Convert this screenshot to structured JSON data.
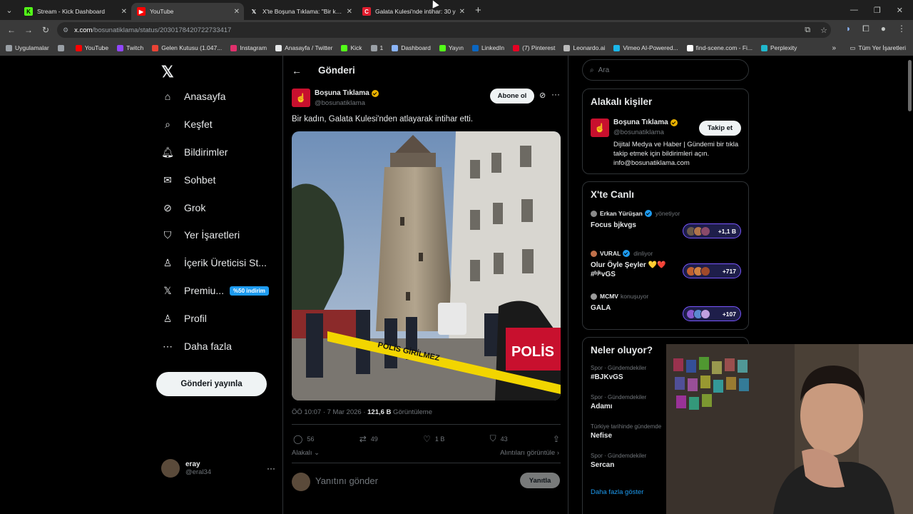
{
  "browser": {
    "tabs": [
      {
        "title": "Stream - Kick Dashboard",
        "icon": "kick-icon",
        "color": "#53fc18",
        "glyph": "K",
        "active": false
      },
      {
        "title": "YouTube",
        "icon": "youtube-icon",
        "color": "#ff0000",
        "glyph": "▶",
        "active": true
      },
      {
        "title": "X'te Boşuna Tıklama: \"Bir kadın",
        "icon": "x-icon",
        "color": "#1f1f1f",
        "glyph": "𝕏",
        "active": false
      },
      {
        "title": "Galata Kulesi'nde intihar: 30 y",
        "icon": "c-icon",
        "color": "#e11d2e",
        "glyph": "C",
        "active": false
      }
    ],
    "url_host": "x.com",
    "url_path": "/bosunatiklama/status/2030178420722733417",
    "bookmarks": [
      {
        "label": "Uygulamalar",
        "icon": "apps-icon",
        "color": "#9aa0a6"
      },
      {
        "label": "",
        "icon": "grid-icon",
        "color": "#9aa0a6"
      },
      {
        "label": "YouTube",
        "icon": "youtube-icon",
        "color": "#ff0000"
      },
      {
        "label": "Twitch",
        "icon": "twitch-icon",
        "color": "#9146ff"
      },
      {
        "label": "Gelen Kutusu (1.047...",
        "icon": "gmail-icon",
        "color": "#ea4335"
      },
      {
        "label": "Instagram",
        "icon": "instagram-icon",
        "color": "#e1306c"
      },
      {
        "label": "Anasayfa / Twitter",
        "icon": "x-icon",
        "color": "#e7e9ea"
      },
      {
        "label": "Kick",
        "icon": "kick-icon",
        "color": "#53fc18"
      },
      {
        "label": "1",
        "icon": "folder-icon",
        "color": "#9aa0a6"
      },
      {
        "label": "Dashboard",
        "icon": "dashboard-icon",
        "color": "#8ab4f8"
      },
      {
        "label": "Yayın",
        "icon": "kick-icon",
        "color": "#53fc18"
      },
      {
        "label": "LinkedIn",
        "icon": "linkedin-icon",
        "color": "#0a66c2"
      },
      {
        "label": "(7) Pinterest",
        "icon": "pinterest-icon",
        "color": "#e60023"
      },
      {
        "label": "Leonardo.ai",
        "icon": "leonardo-icon",
        "color": "#bbbbbb"
      },
      {
        "label": "Vimeo AI-Powered...",
        "icon": "vimeo-icon",
        "color": "#1ab7ea"
      },
      {
        "label": "find-scene.com - Fi...",
        "icon": "findscene-icon",
        "color": "#ffffff"
      },
      {
        "label": "Perplexity",
        "icon": "perplexity-icon",
        "color": "#20b8cd"
      }
    ],
    "all_bookmarks": "Tüm Yer İşaretleri"
  },
  "nav": {
    "items": [
      {
        "label": "Anasayfa",
        "icon": "home-icon",
        "glyph": "⌂"
      },
      {
        "label": "Keşfet",
        "icon": "search-icon",
        "glyph": "⌕"
      },
      {
        "label": "Bildirimler",
        "icon": "bell-icon",
        "glyph": "🔔︎"
      },
      {
        "label": "Sohbet",
        "icon": "mail-icon",
        "glyph": "✉"
      },
      {
        "label": "Grok",
        "icon": "grok-icon",
        "glyph": "⊘"
      },
      {
        "label": "Yer İşaretleri",
        "icon": "bookmark-icon",
        "glyph": "⛉"
      },
      {
        "label": "İçerik Üreticisi St...",
        "icon": "creator-icon",
        "glyph": "♙"
      },
      {
        "label": "Premiu...",
        "icon": "x-premium-icon",
        "glyph": "𝕏"
      },
      {
        "label": "Profil",
        "icon": "person-icon",
        "glyph": "♙"
      },
      {
        "label": "Daha fazla",
        "icon": "more-circle-icon",
        "glyph": "⋯"
      }
    ],
    "premium_badge": "%50 indirim",
    "post_button": "Gönderi yayınla",
    "user_name": "eray",
    "user_handle": "@eral34"
  },
  "post": {
    "header": "Gönderi",
    "author_name": "Boşuna Tıklama",
    "author_handle": "@bosunatiklama",
    "subscribe": "Abone ol",
    "text": "Bir kadın, Galata Kulesi'nden atlayarak intihar etti.",
    "time": "ÖÖ 10:07 · 7 Mar 2026 · ",
    "views": "121,6 B",
    "views_label": " Görüntüleme",
    "tape_text": "POLİS GİRİLMEZ",
    "police_text": "POLİS",
    "stats": {
      "replies": "56",
      "reposts": "49",
      "likes": "1 B",
      "bookmarks": "43"
    },
    "relevant": "Alakalı",
    "quotes": "Alıntıları görüntüle",
    "reply_placeholder": "Yanıtını gönder",
    "reply_button": "Yanıtla"
  },
  "sidebar": {
    "search_placeholder": "Ara",
    "related_title": "Alakalı kişiler",
    "related": {
      "name": "Boşuna Tıklama",
      "handle": "@bosunatiklama",
      "follow": "Takip et",
      "bio": "Dijital Medya ve Haber | Gündemi bir tıkla takip etmek için bildirimleri açın. info@bosunatiklama.com"
    },
    "live_title": "X'te Canlı",
    "live": [
      {
        "host": "Erkan Yürüşan",
        "verb": "yönetiyor",
        "title": "Focus bjkvgs",
        "count": "+1,1 B",
        "host_color": "#8a8a8a"
      },
      {
        "host": "VURAL",
        "verb": "dinliyor",
        "title": "Olur Öyle Şeyler 💛❤️ #ᵇʲᵏvGS",
        "count": "+717",
        "host_color": "#c0704a"
      },
      {
        "host": "MCMV",
        "verb": "konuşuyor",
        "title": "GALA",
        "count": "+107",
        "host_color": "#9a9a9a"
      }
    ],
    "trends_title": "Neler oluyor?",
    "trends": [
      {
        "category": "Spor · Gündemdekiler",
        "name": "#BJKvGS"
      },
      {
        "category": "Spor · Gündemdekiler",
        "name": "Adamı"
      },
      {
        "category": "Türkiye tarihinde gündemde",
        "name": "Nefise"
      },
      {
        "category": "Spor · Gündemdekiler",
        "name": "Sercan"
      }
    ],
    "show_more": "Daha fazla göster"
  }
}
